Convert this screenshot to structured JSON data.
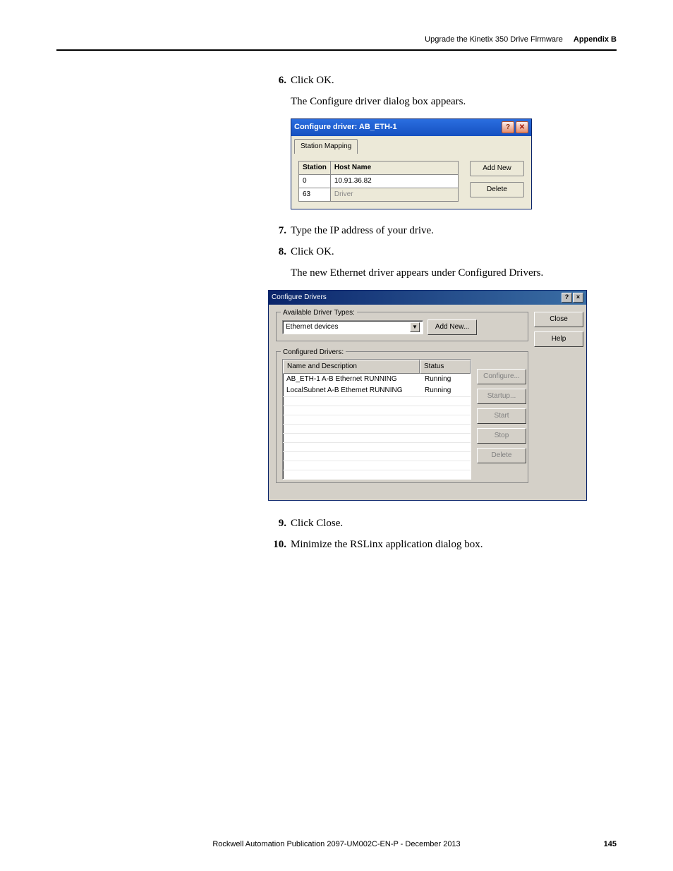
{
  "header": {
    "title": "Upgrade the Kinetix 350 Drive Firmware",
    "appendix": "Appendix B"
  },
  "steps": {
    "s6": {
      "num": "6.",
      "text": "Click OK.",
      "sub": "The Configure driver dialog box appears."
    },
    "s7": {
      "num": "7.",
      "text": "Type the IP address of your drive."
    },
    "s8": {
      "num": "8.",
      "text": "Click OK.",
      "sub": "The new Ethernet driver appears under Configured Drivers."
    },
    "s9": {
      "num": "9.",
      "text": "Click Close."
    },
    "s10": {
      "num": "10.",
      "text": "Minimize the RSLinx application dialog box."
    }
  },
  "dialog1": {
    "title": "Configure driver: AB_ETH-1",
    "tab": "Station Mapping",
    "columns": {
      "station": "Station",
      "host": "Host Name"
    },
    "rows": {
      "r0": {
        "station": "0",
        "host": "10.91.36.82"
      },
      "r1": {
        "station": "63",
        "host": "Driver"
      }
    },
    "buttons": {
      "addnew": "Add New",
      "delete": "Delete"
    }
  },
  "dialog2": {
    "title": "Configure Drivers",
    "group1_label": "Available Driver Types:",
    "select_value": "Ethernet devices",
    "addnew": "Add New...",
    "group2_label": "Configured Drivers:",
    "columns": {
      "name": "Name and Description",
      "status": "Status"
    },
    "rows": {
      "r0": {
        "name": "AB_ETH-1  A-B Ethernet  RUNNING",
        "status": "Running"
      },
      "r1": {
        "name": "LocalSubnet  A-B Ethernet  RUNNING",
        "status": "Running"
      }
    },
    "buttons": {
      "close": "Close",
      "help": "Help",
      "configure": "Configure...",
      "startup": "Startup...",
      "start": "Start",
      "stop": "Stop",
      "delete": "Delete"
    }
  },
  "footer": {
    "pub": "Rockwell Automation Publication 2097-UM002C-EN-P - December 2013",
    "page": "145"
  }
}
